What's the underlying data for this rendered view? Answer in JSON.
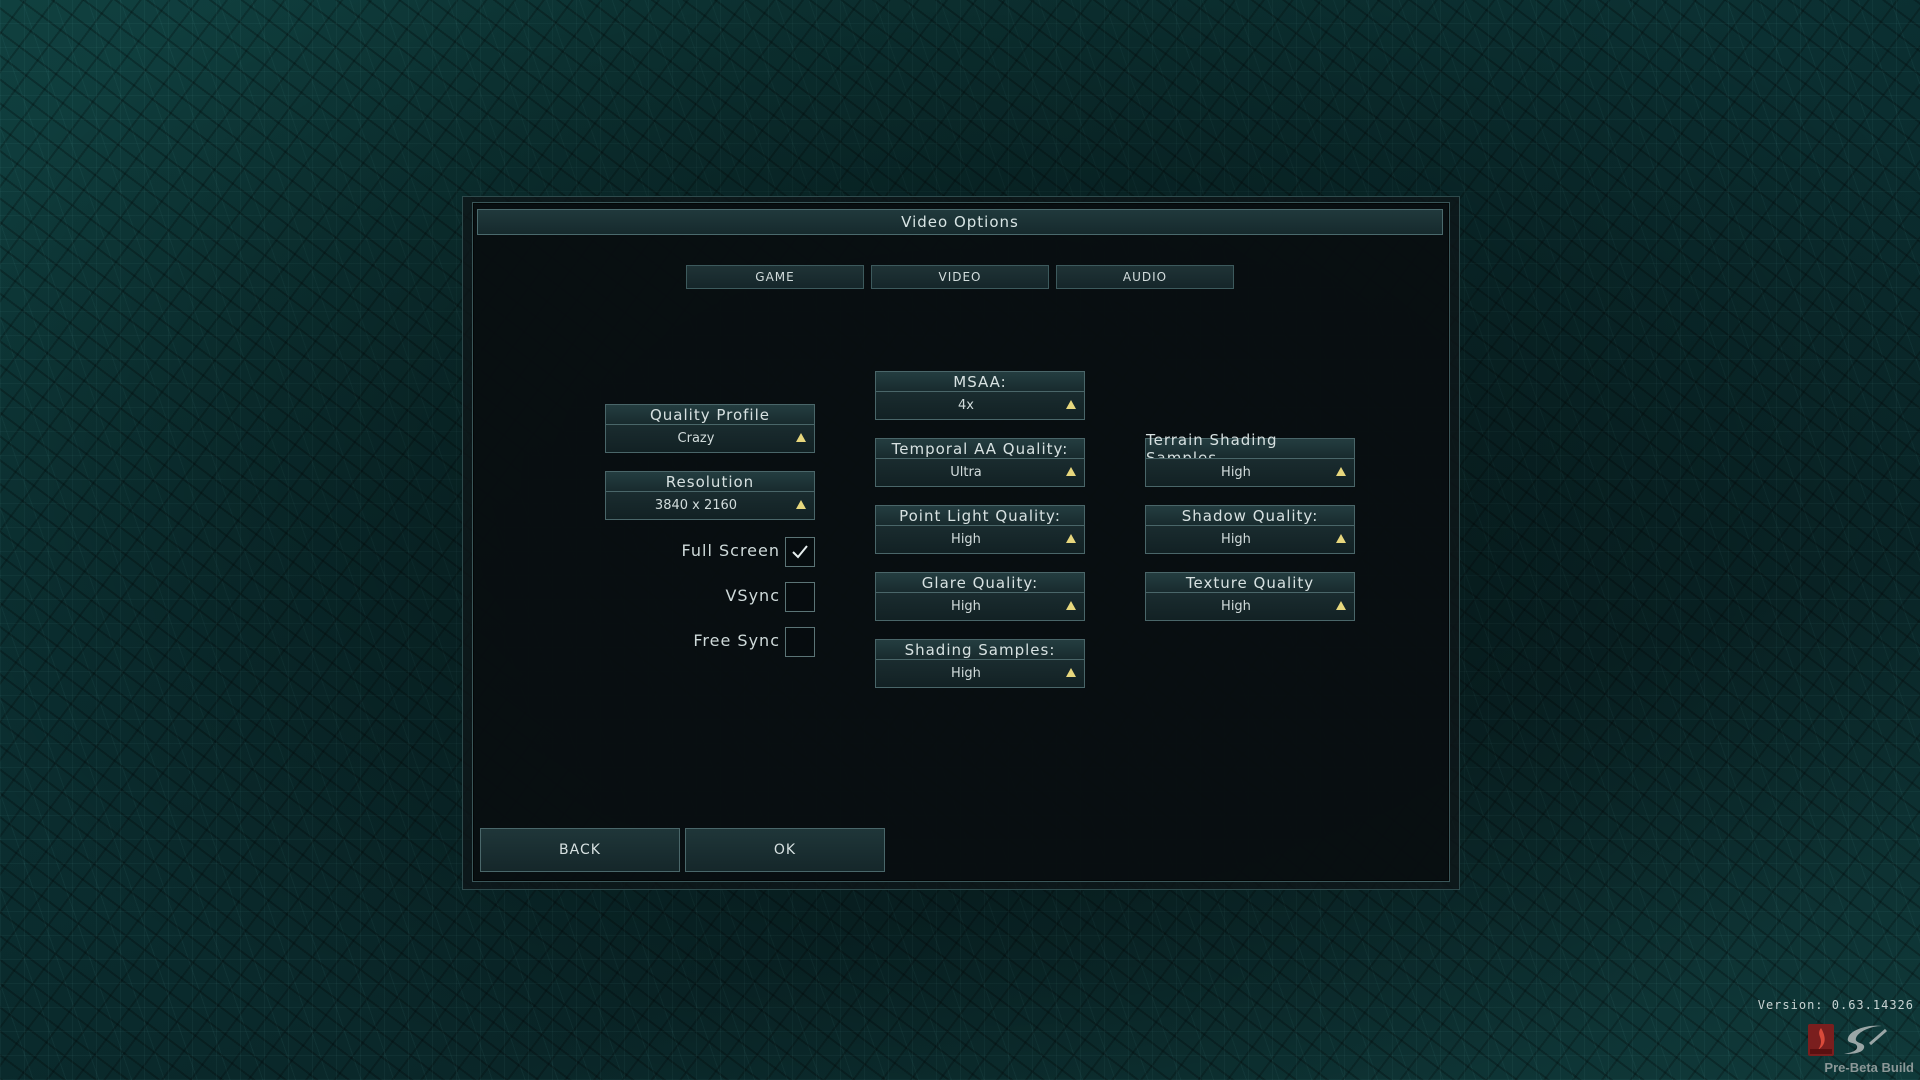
{
  "dialog": {
    "title": "Video Options"
  },
  "tabs": [
    {
      "label": "GAME"
    },
    {
      "label": "VIDEO"
    },
    {
      "label": "AUDIO"
    }
  ],
  "left_column": {
    "quality_profile": {
      "label": "Quality Profile",
      "value": "Crazy"
    },
    "resolution": {
      "label": "Resolution",
      "value": "3840 x 2160"
    },
    "checkboxes": [
      {
        "label": "Full Screen",
        "checked": true
      },
      {
        "label": "VSync",
        "checked": false
      },
      {
        "label": "Free Sync",
        "checked": false
      }
    ]
  },
  "middle_column": [
    {
      "label": "MSAA:",
      "value": "4x"
    },
    {
      "label": "Temporal AA Quality:",
      "value": "Ultra"
    },
    {
      "label": "Point Light Quality:",
      "value": "High"
    },
    {
      "label": "Glare Quality:",
      "value": "High"
    },
    {
      "label": "Shading Samples:",
      "value": "High"
    }
  ],
  "right_column": [
    {
      "label": "Terrain Shading Samples",
      "value": "High"
    },
    {
      "label": "Shadow Quality:",
      "value": "High"
    },
    {
      "label": "Texture Quality",
      "value": "High"
    }
  ],
  "buttons": {
    "back": "BACK",
    "ok": "OK"
  },
  "footer": {
    "version": "Version: 0.63.14326",
    "build": "Pre-Beta Build"
  },
  "colors": {
    "accent_arrow": "#e7d77d",
    "panel_border": "#4a6669",
    "background": "#0b2f31"
  }
}
